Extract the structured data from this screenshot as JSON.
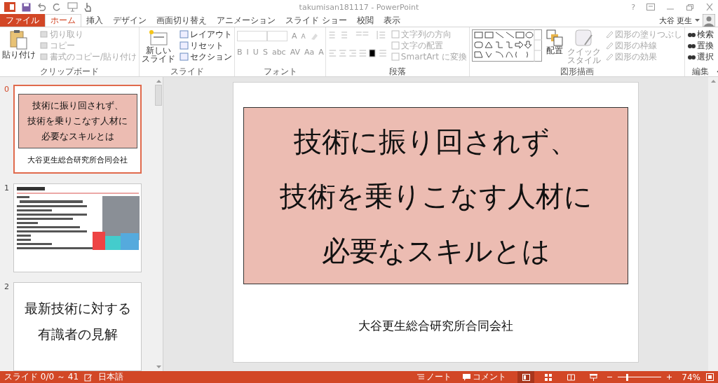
{
  "title_bar": {
    "document_title": "takumisan181117 - PowerPoint",
    "help": "?"
  },
  "tabs": [
    {
      "label": "ファイル",
      "kind": "file",
      "selected": false
    },
    {
      "label": "ホーム",
      "kind": "tab",
      "selected": true
    },
    {
      "label": "挿入",
      "kind": "tab",
      "selected": false
    },
    {
      "label": "デザイン",
      "kind": "tab",
      "selected": false
    },
    {
      "label": "画面切り替え",
      "kind": "tab",
      "selected": false
    },
    {
      "label": "アニメーション",
      "kind": "tab",
      "selected": false
    },
    {
      "label": "スライド ショー",
      "kind": "tab",
      "selected": false
    },
    {
      "label": "校閲",
      "kind": "tab",
      "selected": false
    },
    {
      "label": "表示",
      "kind": "tab",
      "selected": false
    }
  ],
  "user": {
    "name": "大谷 更生"
  },
  "ribbon": {
    "clipboard": {
      "label": "クリップボード",
      "paste": "貼り付け",
      "items": [
        {
          "label": "切り取り",
          "disabled": true
        },
        {
          "label": "コピー",
          "disabled": true
        },
        {
          "label": "書式のコピー/貼り付け",
          "disabled": true
        }
      ]
    },
    "slides": {
      "label": "スライド",
      "new_slide": [
        "新しい",
        "スライド"
      ],
      "items": [
        {
          "label": "レイアウト",
          "disabled": false
        },
        {
          "label": "リセット",
          "disabled": false
        },
        {
          "label": "セクション",
          "disabled": false
        }
      ]
    },
    "font": {
      "label": "フォント",
      "grow": "A",
      "shrink": "A",
      "buttons": [
        "B",
        "I",
        "U",
        "S",
        "abc",
        "AV",
        "Aa",
        "A"
      ]
    },
    "paragraph": {
      "label": "段落",
      "items": [
        {
          "label": "文字列の方向",
          "disabled": true
        },
        {
          "label": "文字の配置",
          "disabled": true
        },
        {
          "label": "SmartArt に変換",
          "disabled": true
        }
      ]
    },
    "drawing": {
      "label": "図形描画",
      "arrange": "配置",
      "quick_style": [
        "クイック",
        "スタイル"
      ],
      "items": [
        {
          "label": "図形の塗りつぶし",
          "disabled": true
        },
        {
          "label": "図形の枠線",
          "disabled": true
        },
        {
          "label": "図形の効果",
          "disabled": true
        }
      ]
    },
    "editing": {
      "label": "編集",
      "items": [
        {
          "label": "検索",
          "disabled": false
        },
        {
          "label": "置換",
          "disabled": false
        },
        {
          "label": "選択",
          "disabled": false
        }
      ]
    }
  },
  "thumbnails": [
    {
      "number": "0",
      "kind": "title",
      "selected": true,
      "lines": [
        "技術に振り回されず、",
        "技術を乗りこなす人材に",
        "必要なスキルとは"
      ],
      "subtitle": "大谷更生総合研究所合同会社"
    },
    {
      "number": "1",
      "kind": "profile",
      "selected": false
    },
    {
      "number": "2",
      "kind": "text",
      "selected": false,
      "lines": [
        "最新技術に対する",
        "有識者の見解"
      ]
    }
  ],
  "slide": {
    "title_lines": [
      "技術に振り回されず、",
      "技術を乗りこなす人材に",
      "必要なスキルとは"
    ],
    "subtitle": "大谷更生総合研究所合同会社"
  },
  "status_bar": {
    "slide_info": "スライド 0/0 ～ 41",
    "language": "日本語",
    "notes": "ノート",
    "comments": "コメント",
    "zoom": {
      "level": 0.22
    },
    "zoom_percent": "74%"
  }
}
